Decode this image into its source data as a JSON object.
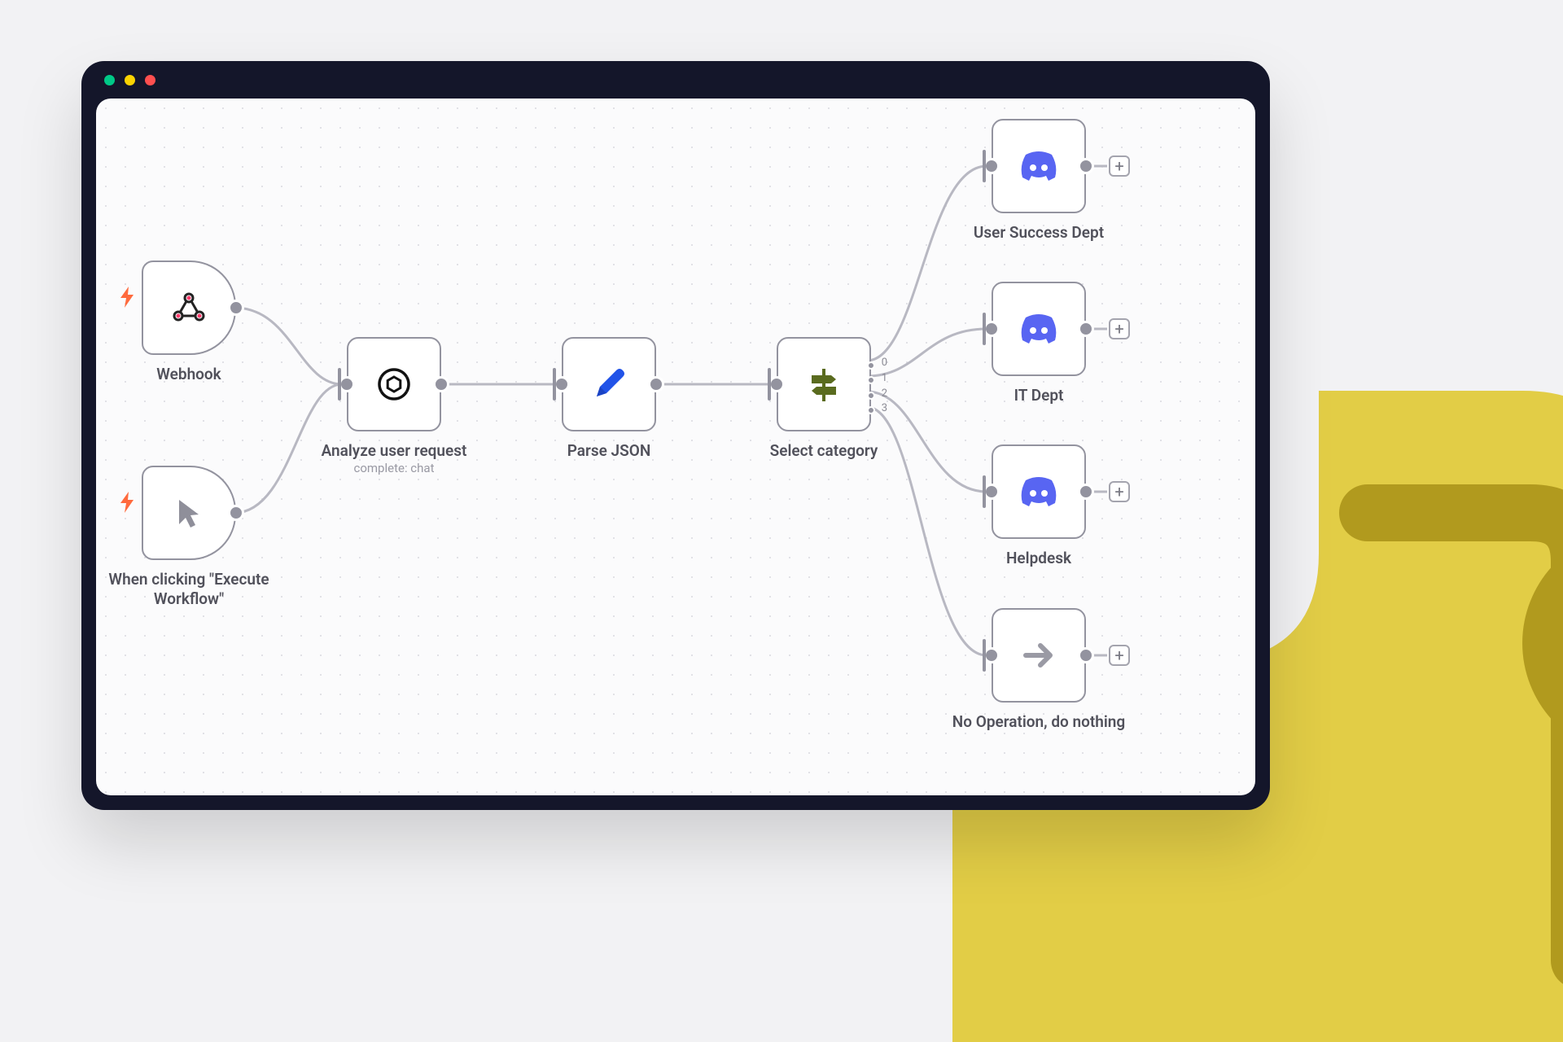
{
  "colors": {
    "accent_orange": "#ff6a3d",
    "discord_purple": "#5865F2",
    "pencil_blue": "#2153E8",
    "signpost_green": "#5a6b1f",
    "node_border": "#93939f",
    "decoration_yellow": "#d9bf2f"
  },
  "triggers": {
    "webhook": {
      "label": "Webhook",
      "icon": "webhook-icon"
    },
    "manual": {
      "label": "When clicking \"Execute Workflow\"",
      "icon": "cursor-icon"
    }
  },
  "nodes": {
    "analyze": {
      "label": "Analyze user request",
      "sublabel": "complete: chat",
      "icon": "openai-icon"
    },
    "parse": {
      "label": "Parse JSON",
      "icon": "pencil-icon"
    },
    "select": {
      "label": "Select category",
      "icon": "signpost-icon",
      "branches": [
        "0",
        "1",
        "2",
        "3"
      ]
    }
  },
  "outputs": {
    "user_success": {
      "label": "User Success Dept",
      "icon": "discord-icon"
    },
    "it_dept": {
      "label": "IT Dept",
      "icon": "discord-icon"
    },
    "helpdesk": {
      "label": "Helpdesk",
      "icon": "discord-icon"
    },
    "noop": {
      "label": "No Operation, do nothing",
      "icon": "arrow-right-icon"
    }
  },
  "plus_label": "+"
}
